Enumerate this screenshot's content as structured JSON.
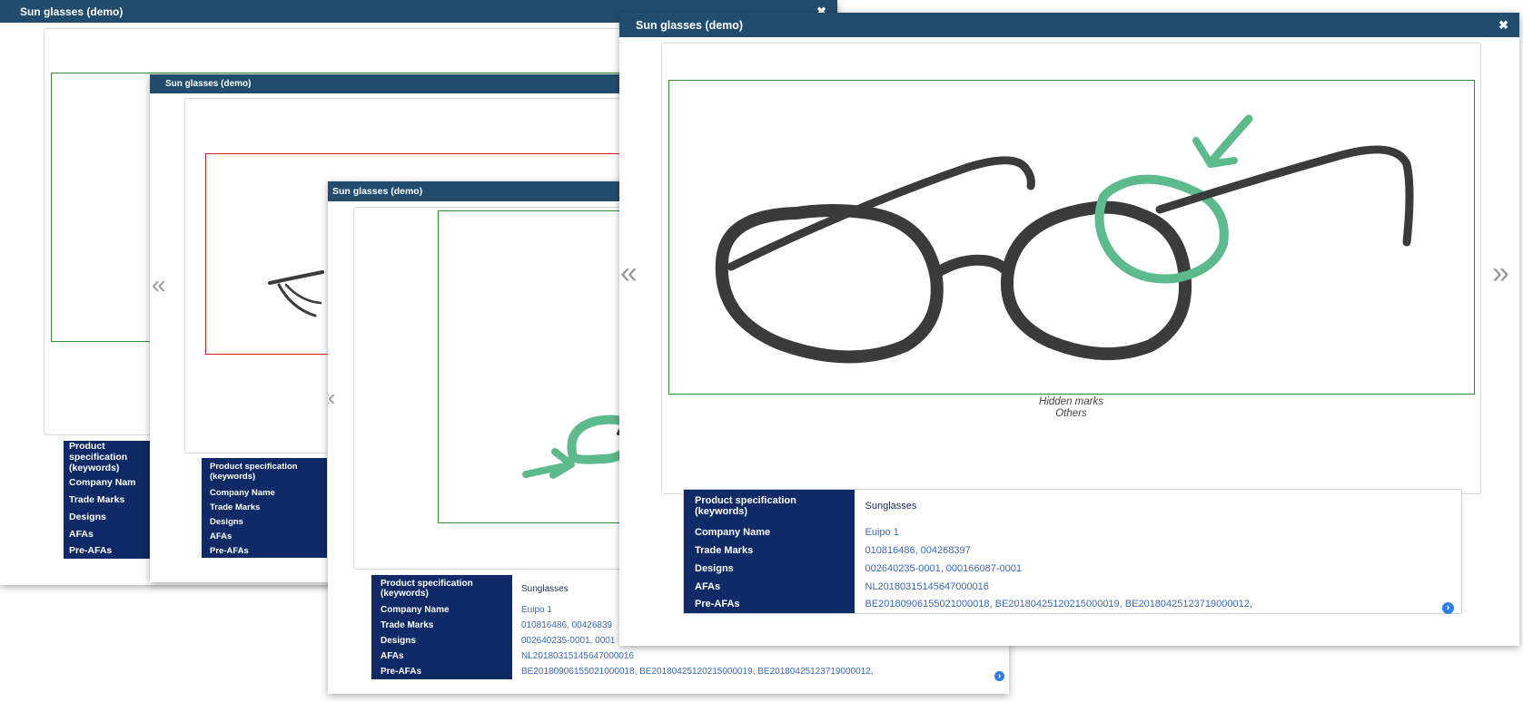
{
  "modal_title": "Sun glasses (demo)",
  "close_glyph": "✖",
  "prev_glyph": "«",
  "next_glyph": "»",
  "caption": {
    "line1": "Hidden marks",
    "line2": "Others"
  },
  "spec": {
    "product_label": "Product specification (keywords)",
    "product_value": "Sunglasses",
    "company_label": "Company Name",
    "company_value": "Euipo 1",
    "trademarks_label": "Trade Marks",
    "trademarks_value": "010816486, 004268397",
    "trademarks_value_partial": "010816486, 00426839",
    "designs_label": "Designs",
    "designs_value": "002640235-0001, 000166087-0001",
    "designs_value_partial": "002640235-0001, 0001",
    "afas_label": "AFAs",
    "afas_value": "NL20180315145647000016",
    "preafas_label": "Pre-AFAs",
    "preafas_value": "BE20180906155021000018, BE20180425120215000019, BE20180425123719000012,",
    "company_label_partial": "Company Nam",
    "expand_glyph": "›"
  },
  "colors": {
    "header": "#224c6d",
    "spec_key_bg": "#0f2a66",
    "frame_green": "#2e8b2e",
    "frame_red": "#e02020",
    "link_blue": "#3a68b8",
    "ink": "#3b3b3b",
    "mint": "#5cba8c"
  }
}
